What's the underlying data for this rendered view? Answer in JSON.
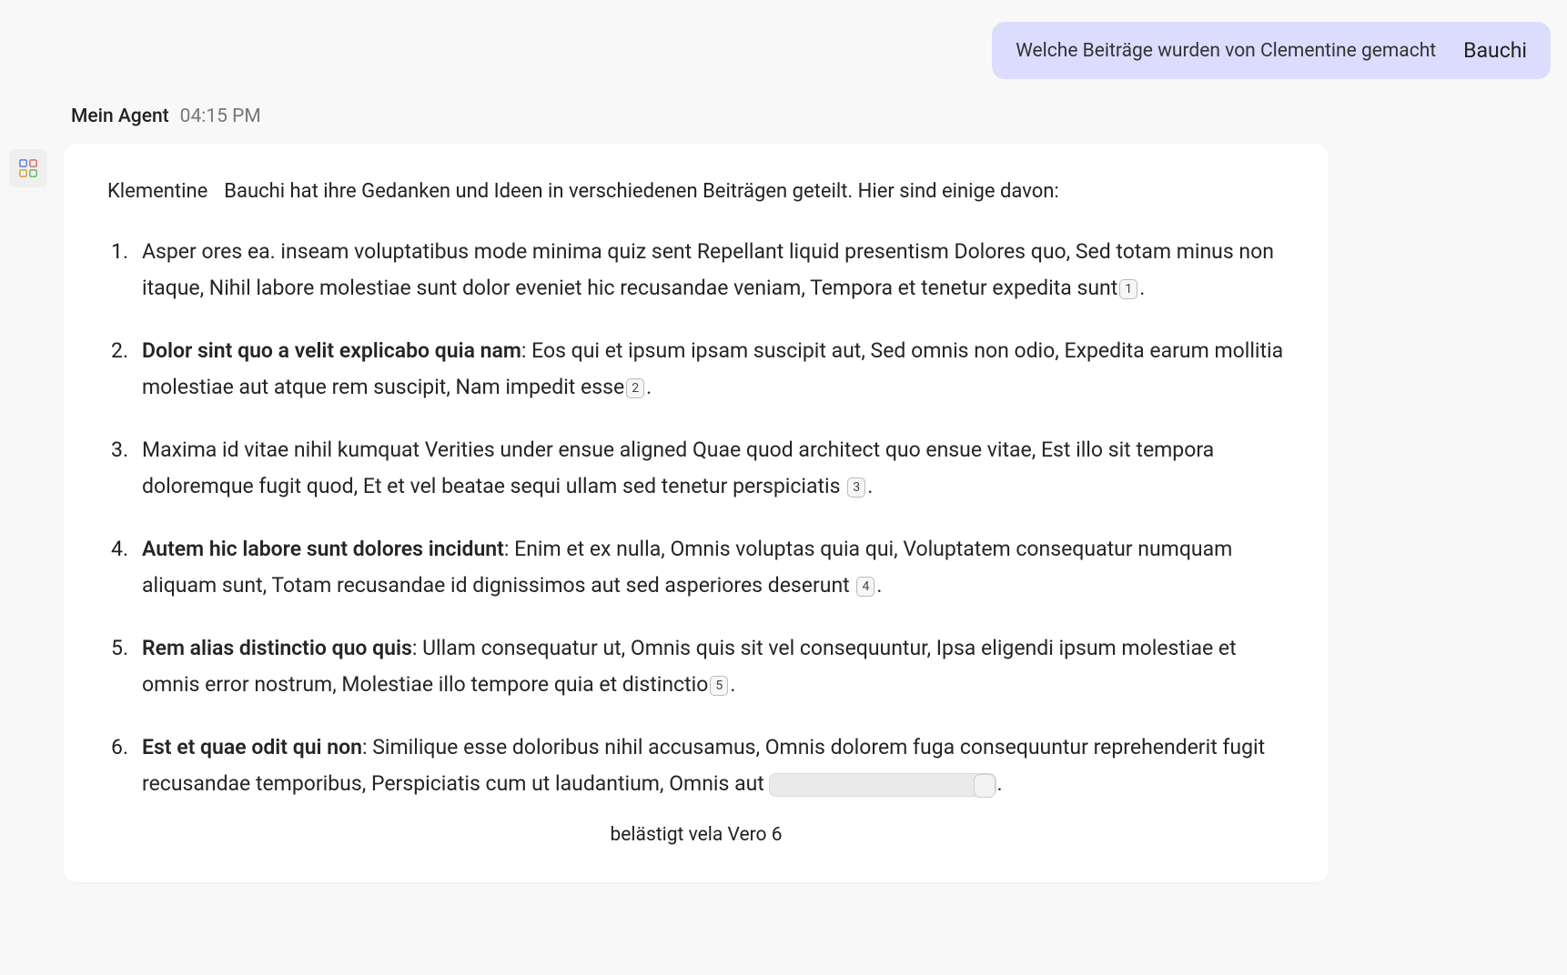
{
  "user_message": {
    "text": "Welche Beiträge wurden von Clementine gemacht",
    "tag": "Bauchi"
  },
  "agent": {
    "name": "Mein Agent",
    "time": "04:15 PM"
  },
  "intro": {
    "name1": "Klementine",
    "name2": "Bauchi",
    "rest": " hat ihre Gedanken und Ideen in verschiedenen Beiträgen geteilt. Hier sind einige davon:"
  },
  "items": [
    {
      "lead_bold": "",
      "lead_plain": "Asper ores ea. inseam voluptatibus mode minima quiz sent Repellant liquid presentism Dolores quo,",
      "body": " Sed totam minus non itaque, Nihil labore molestiae sunt dolor eveniet hic recusandae veniam, Tempora et tenetur expedita sunt",
      "cite": "1",
      "tail": "."
    },
    {
      "lead_bold": "Dolor sint quo a velit explicabo quia nam",
      "lead_plain": "",
      "body": ": Eos qui et ipsum ipsam suscipit aut, Sed omnis non odio, Expedita earum mollitia molestiae aut atque rem suscipit, Nam impedit esse",
      "cite": "2",
      "tail": "."
    },
    {
      "lead_bold": "",
      "lead_plain": "Maxima id vitae nihil kumquat Verities under ensue aligned Quae quod architect quo ensue",
      "body": " vitae, Est illo sit tempora doloremque fugit quod, Et et vel beatae sequi ullam sed tenetur perspiciatis ",
      "cite": "3",
      "tail": "."
    },
    {
      "lead_bold": "Autem hic labore sunt dolores incidunt",
      "lead_plain": "",
      "body": ": Enim et ex nulla, Omnis voluptas quia qui, Voluptatem consequatur numquam aliquam sunt, Totam recusandae id dignissimos aut sed asperiores deserunt ",
      "cite": "4",
      "tail": "."
    },
    {
      "lead_bold": "Rem alias distinctio quo quis",
      "lead_plain": "",
      "body": ": Ullam consequatur ut, Omnis quis sit vel consequuntur, Ipsa eligendi ipsum molestiae et omnis error nostrum, Molestiae illo tempore quia et distinctio",
      "cite": "5",
      "tail": "."
    },
    {
      "lead_bold": "Est et quae odit qui non",
      "lead_plain": "",
      "body": ": Similique esse doloribus nihil accusamus, Omnis dolorem fuga consequuntur reprehenderit fugit recusandae temporibus, Perspiciatis cum ut laudantium, Omnis aut ",
      "cite": "",
      "tail": "."
    }
  ],
  "footer": "belästigt vela Vero 6"
}
